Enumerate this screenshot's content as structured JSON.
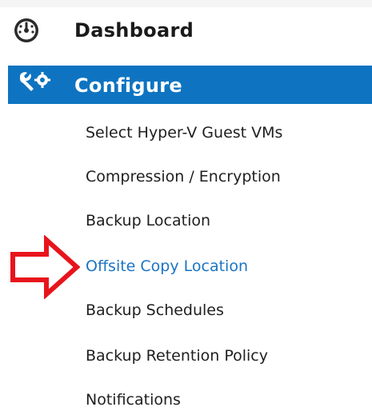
{
  "nav": {
    "dashboard": {
      "label": "Dashboard",
      "icon": "gauge-icon"
    },
    "configure": {
      "label": "Configure",
      "icon": "tools-icon",
      "highlight_color": "#0e74c1"
    },
    "sub_items": [
      {
        "label": "Select Hyper-V Guest VMs"
      },
      {
        "label": "Compression / Encryption"
      },
      {
        "label": "Backup Location"
      },
      {
        "label": "Offsite Copy Location"
      },
      {
        "label": "Backup Schedules"
      },
      {
        "label": "Backup Retention Policy"
      },
      {
        "label": "Notifications"
      }
    ],
    "active_sub_item": "Offsite Copy Location",
    "active_color": "#1b74c3"
  },
  "annotation": {
    "icon": "red-arrow-icon",
    "color": "#e8141c"
  }
}
